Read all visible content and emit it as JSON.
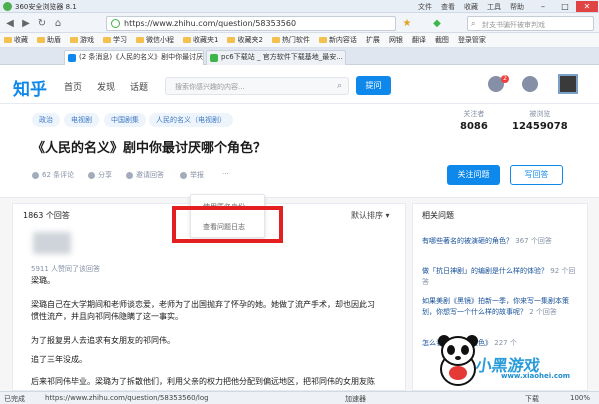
{
  "browser": {
    "title": "360安全浏览器 8.1",
    "menu": [
      "文件",
      "查看",
      "收藏",
      "工具",
      "帮助"
    ],
    "url": "https://www.zhihu.com/question/58353560",
    "search_placeholder": "封支书骗歼被审判戏"
  },
  "bookmarks": [
    "收藏",
    "助盾",
    "游戏",
    "学习",
    "微信小程",
    "收藏夹1",
    "收藏夹2",
    "热门软件",
    "新内容话",
    "扩展",
    "网银",
    "翻译",
    "截图",
    "登录管家"
  ],
  "tabs": [
    {
      "label": "(2 条消息)《人民的名义》剧中你最讨厌...",
      "active": true
    },
    {
      "label": "pc6下载站 _ 官方软件下载基地_最安...",
      "active": false
    }
  ],
  "zhihu": {
    "logo": "知乎",
    "nav": [
      "首页",
      "发现",
      "话题"
    ],
    "search_placeholder": "搜索你感兴趣的内容...",
    "ask": "提问",
    "badge": "2"
  },
  "question": {
    "topics": [
      "政治",
      "电视剧",
      "中国剧集",
      "人民的名义（电视剧）"
    ],
    "followers_label": "关注者",
    "followers": "8086",
    "views_label": "被浏览",
    "views": "12459078",
    "title": "《人民的名义》剧中你最讨厌哪个角色？",
    "actions": [
      "62 条评论",
      "分享",
      "邀请回答",
      "举报",
      "···"
    ],
    "follow_button": "关注问题",
    "write_button": "写回答"
  },
  "dropdown": [
    "使用匿名身份",
    "查看问题日志"
  ],
  "answers": {
    "count": "1863 个回答",
    "sort": "默认排序",
    "meta": "5911 人赞同了该回答",
    "paragraphs": [
      "梁璐。",
      "梁璐自己在大学期间和老师谈恋爱，老师为了出国抛弃了怀孕的她。她做了流产手术，却也因此习",
      "惯性流产，并且向祁同伟隐瞒了这一事实。",
      "为了报复男人去追求有女朋友的祁同伟。",
      "追了三年没成。",
      "后来祁同伟毕业。梁璐为了拆散他们，利用父亲的权力把他分配到偏远地区，把祁同伟的女朋友陈"
    ]
  },
  "related": {
    "title": "相关问题",
    "items": [
      {
        "text": "有哪些著名的被演砸的角色？",
        "count": "367 个回答"
      },
      {
        "text": "做「抗日神剧」的编剧是什么样的体验？",
        "count": "92 个回答"
      },
      {
        "text": "如果美剧《黑镜》拍新一季，你来写一集剧本策划，你想写一个什么样的故事呢？",
        "count": "2 个回答"
      },
      {
        "text": "怎么看电视剧《红色》",
        "count": "227 个"
      }
    ]
  },
  "status": {
    "left": "已完成",
    "url": "https://www.zhihu.com/question/58353560/log",
    "speed": "加速器",
    "download": "下载",
    "zoom": "100%"
  },
  "watermark": {
    "brand": "小黑游戏",
    "site": "www.xiaohei.com"
  }
}
